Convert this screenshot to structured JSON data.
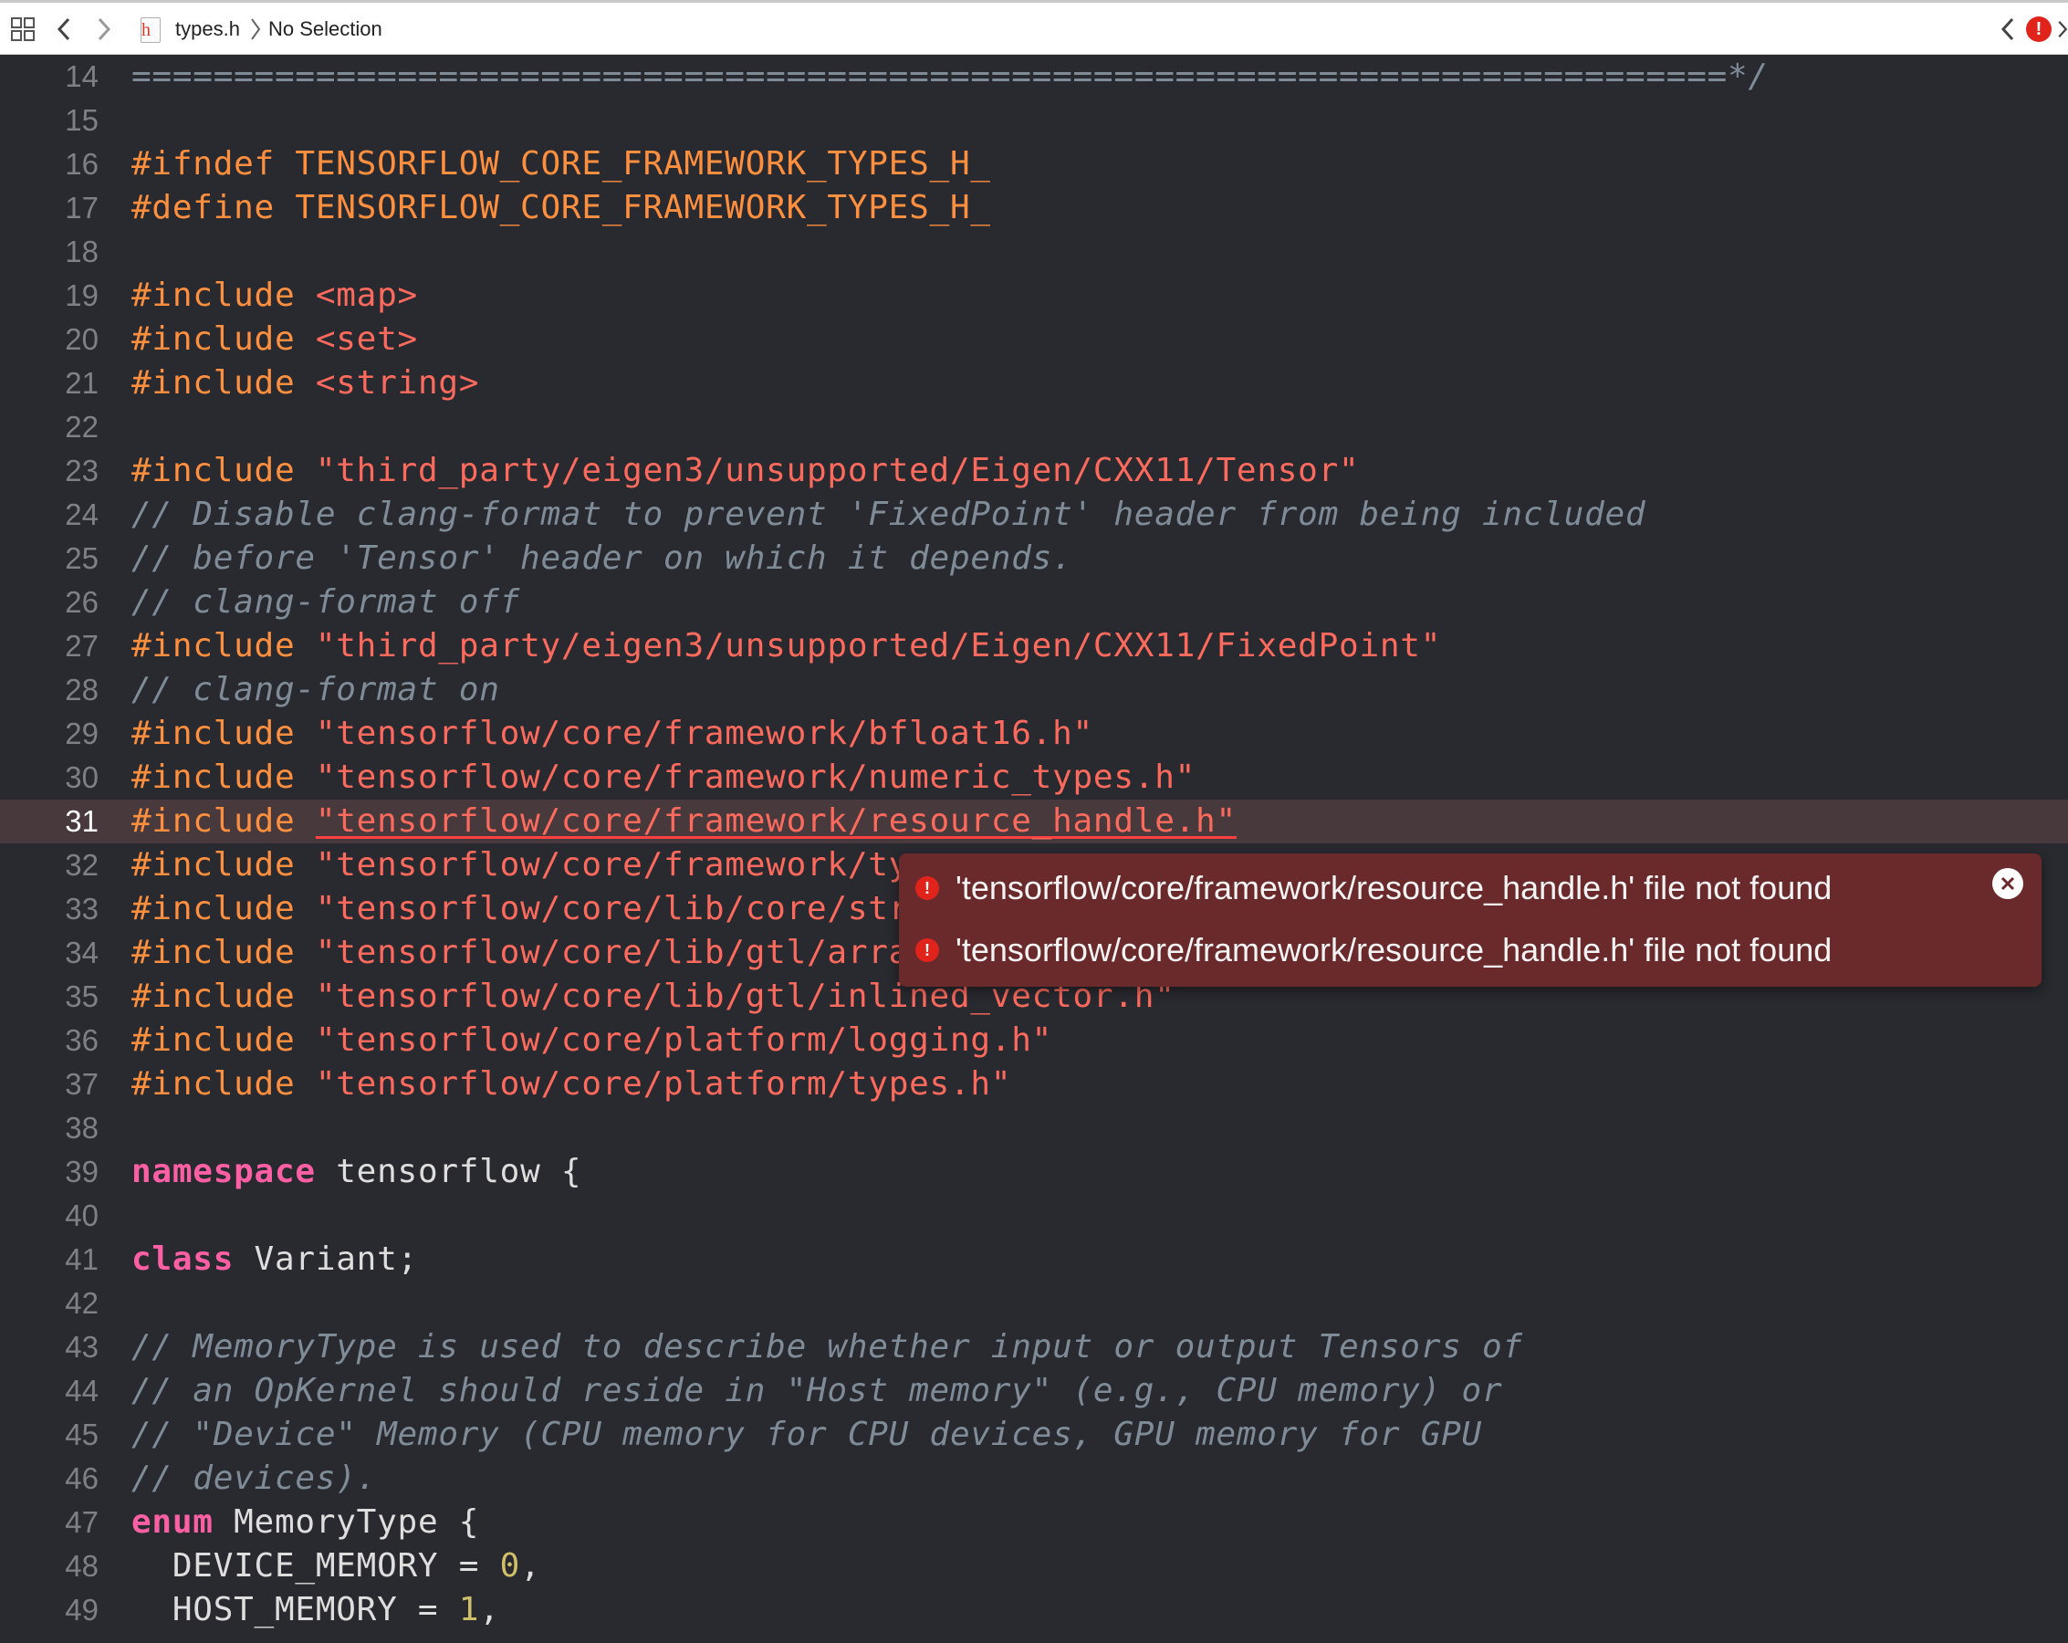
{
  "jumpbar": {
    "file_name": "types.h",
    "file_icon_letter": "h",
    "selection": "No Selection",
    "icons": [
      "related-items-grid-icon",
      "back-chevron-icon",
      "forward-chevron-icon",
      "header-file-icon",
      "breadcrumb-chevron-icon",
      "issue-back-icon",
      "issue-error-icon",
      "issue-forward-icon"
    ]
  },
  "editor": {
    "current_line": 31,
    "lines": [
      {
        "n": "14",
        "tokens": [
          {
            "c": "com",
            "t": "==============================================================================*/"
          }
        ]
      },
      {
        "n": "15",
        "tokens": []
      },
      {
        "n": "16",
        "tokens": [
          {
            "c": "pp",
            "t": "#ifndef "
          },
          {
            "c": "ppname",
            "t": "TENSORFLOW_CORE_FRAMEWORK_TYPES_H_"
          }
        ]
      },
      {
        "n": "17",
        "tokens": [
          {
            "c": "pp",
            "t": "#define "
          },
          {
            "c": "ppname",
            "t": "TENSORFLOW_CORE_FRAMEWORK_TYPES_H_"
          }
        ]
      },
      {
        "n": "18",
        "tokens": []
      },
      {
        "n": "19",
        "tokens": [
          {
            "c": "pp",
            "t": "#include "
          },
          {
            "c": "str",
            "t": "<map>"
          }
        ]
      },
      {
        "n": "20",
        "tokens": [
          {
            "c": "pp",
            "t": "#include "
          },
          {
            "c": "str",
            "t": "<set>"
          }
        ]
      },
      {
        "n": "21",
        "tokens": [
          {
            "c": "pp",
            "t": "#include "
          },
          {
            "c": "str",
            "t": "<string>"
          }
        ]
      },
      {
        "n": "22",
        "tokens": []
      },
      {
        "n": "23",
        "tokens": [
          {
            "c": "pp",
            "t": "#include "
          },
          {
            "c": "str",
            "t": "\"third_party/eigen3/unsupported/Eigen/CXX11/Tensor\""
          }
        ]
      },
      {
        "n": "24",
        "tokens": [
          {
            "c": "com",
            "t": "// Disable clang-format to prevent 'FixedPoint' header from being included"
          }
        ]
      },
      {
        "n": "25",
        "tokens": [
          {
            "c": "com",
            "t": "// before 'Tensor' header on which it depends."
          }
        ]
      },
      {
        "n": "26",
        "tokens": [
          {
            "c": "com",
            "t": "// clang-format off"
          }
        ]
      },
      {
        "n": "27",
        "tokens": [
          {
            "c": "pp",
            "t": "#include "
          },
          {
            "c": "str",
            "t": "\"third_party/eigen3/unsupported/Eigen/CXX11/FixedPoint\""
          }
        ]
      },
      {
        "n": "28",
        "tokens": [
          {
            "c": "com",
            "t": "// clang-format on"
          }
        ]
      },
      {
        "n": "29",
        "tokens": [
          {
            "c": "pp",
            "t": "#include "
          },
          {
            "c": "str",
            "t": "\"tensorflow/core/framework/bfloat16.h\""
          }
        ]
      },
      {
        "n": "30",
        "tokens": [
          {
            "c": "pp",
            "t": "#include "
          },
          {
            "c": "str",
            "t": "\"tensorflow/core/framework/numeric_types.h\""
          }
        ]
      },
      {
        "n": "31",
        "tokens": [
          {
            "c": "pp",
            "t": "#include "
          },
          {
            "c": "err",
            "t": "\"tensorflow/core/framework/resource_handle.h\""
          }
        ]
      },
      {
        "n": "32",
        "tokens": [
          {
            "c": "pp",
            "t": "#include "
          },
          {
            "c": "str",
            "t": "\"tensorflow/core/framework/ty"
          }
        ]
      },
      {
        "n": "33",
        "tokens": [
          {
            "c": "pp",
            "t": "#include "
          },
          {
            "c": "str",
            "t": "\"tensorflow/core/lib/core/str"
          }
        ]
      },
      {
        "n": "34",
        "tokens": [
          {
            "c": "pp",
            "t": "#include "
          },
          {
            "c": "str",
            "t": "\"tensorflow/core/lib/gtl/arra"
          }
        ]
      },
      {
        "n": "35",
        "tokens": [
          {
            "c": "pp",
            "t": "#include "
          },
          {
            "c": "str",
            "t": "\"tensorflow/core/lib/gtl/inlined_vector.h\""
          }
        ]
      },
      {
        "n": "36",
        "tokens": [
          {
            "c": "pp",
            "t": "#include "
          },
          {
            "c": "str",
            "t": "\"tensorflow/core/platform/logging.h\""
          }
        ]
      },
      {
        "n": "37",
        "tokens": [
          {
            "c": "pp",
            "t": "#include "
          },
          {
            "c": "str",
            "t": "\"tensorflow/core/platform/types.h\""
          }
        ]
      },
      {
        "n": "38",
        "tokens": []
      },
      {
        "n": "39",
        "tokens": [
          {
            "c": "kw",
            "t": "namespace"
          },
          {
            "c": "plain",
            "t": " tensorflow {"
          }
        ]
      },
      {
        "n": "40",
        "tokens": []
      },
      {
        "n": "41",
        "tokens": [
          {
            "c": "kw",
            "t": "class"
          },
          {
            "c": "plain",
            "t": " Variant;"
          }
        ]
      },
      {
        "n": "42",
        "tokens": []
      },
      {
        "n": "43",
        "tokens": [
          {
            "c": "com",
            "t": "// MemoryType is used to describe whether input or output Tensors of"
          }
        ]
      },
      {
        "n": "44",
        "tokens": [
          {
            "c": "com",
            "t": "// an OpKernel should reside in \"Host memory\" (e.g., CPU memory) or"
          }
        ]
      },
      {
        "n": "45",
        "tokens": [
          {
            "c": "com",
            "t": "// \"Device\" Memory (CPU memory for CPU devices, GPU memory for GPU"
          }
        ]
      },
      {
        "n": "46",
        "tokens": [
          {
            "c": "com",
            "t": "// devices)."
          }
        ]
      },
      {
        "n": "47",
        "tokens": [
          {
            "c": "kw",
            "t": "enum"
          },
          {
            "c": "plain",
            "t": " MemoryType {"
          }
        ]
      },
      {
        "n": "48",
        "tokens": [
          {
            "c": "plain",
            "t": "  DEVICE_MEMORY = "
          },
          {
            "c": "num",
            "t": "0"
          },
          {
            "c": "plain",
            "t": ","
          }
        ]
      },
      {
        "n": "49",
        "tokens": [
          {
            "c": "plain",
            "t": "  HOST_MEMORY = "
          },
          {
            "c": "num",
            "t": "1"
          },
          {
            "c": "plain",
            "t": ","
          }
        ]
      }
    ]
  },
  "errors": {
    "messages": [
      "'tensorflow/core/framework/resource_handle.h' file not found",
      "'tensorflow/core/framework/resource_handle.h' file not found"
    ],
    "icon": "error-icon",
    "close_icon": "close-icon"
  },
  "colors": {
    "background": "#292a30",
    "current_line": "#47393c",
    "preprocessor": "#fd8f3f",
    "string": "#fc6a5d",
    "comment": "#7f8c98",
    "keyword": "#fc5fa3",
    "number": "#d0bf69",
    "error_popover": "#6a2a2c",
    "error_badge": "#e0241c"
  }
}
